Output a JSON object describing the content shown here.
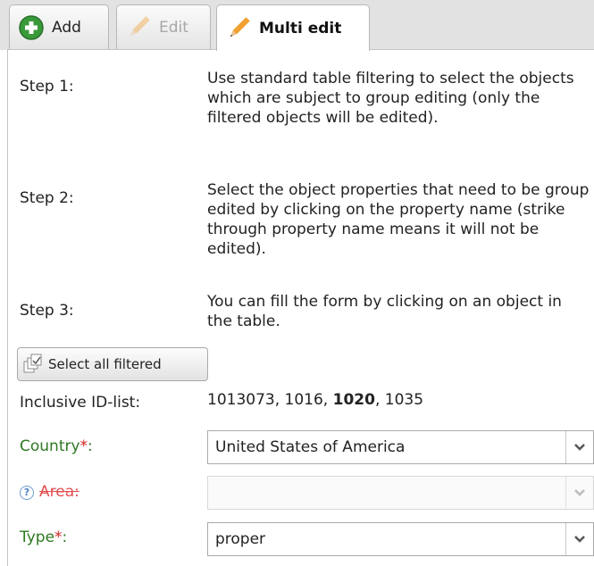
{
  "tabs": [
    {
      "label": "Add",
      "icon": "plus-circle-icon",
      "state": "normal"
    },
    {
      "label": "Edit",
      "icon": "pencil-icon",
      "state": "disabled"
    },
    {
      "label": "Multi edit",
      "icon": "pencil-icon",
      "state": "active"
    }
  ],
  "steps": [
    {
      "label": "Step 1:",
      "text": "Use standard table filtering to select the objects which are subject to group editing (only the filtered objects will be edited)."
    },
    {
      "label": "Step 2:",
      "text": "Select the object properties that need to be group edited by clicking on the property name (strike through property name means it will not be edited)."
    },
    {
      "label": "Step 3:",
      "text": "You can fill the form by clicking on an object in the table."
    }
  ],
  "select_all_button": {
    "label": "Select all filtered",
    "icon": "select-all-icon"
  },
  "id_list": {
    "label": "Inclusive ID-list:",
    "ids": [
      "1013073",
      "1016",
      "1020",
      "1035"
    ],
    "bold_id": "1020",
    "separator": ", "
  },
  "fields": {
    "country": {
      "label": "Country",
      "required_mark": "*",
      "suffix": ":",
      "value": "United States of America"
    },
    "area": {
      "label": "Area:",
      "help_icon": "?",
      "value": ""
    },
    "type": {
      "label": "Type",
      "required_mark": "*",
      "suffix": ":",
      "value": "proper"
    }
  },
  "colors": {
    "tab_bar_bg": "#e2e2e2",
    "label_green": "#2d7a21",
    "required_red": "#d02020",
    "struck_label": "#e05050",
    "add_icon_green": "#3a9a3a",
    "pencil_orange": "#f0a030"
  }
}
